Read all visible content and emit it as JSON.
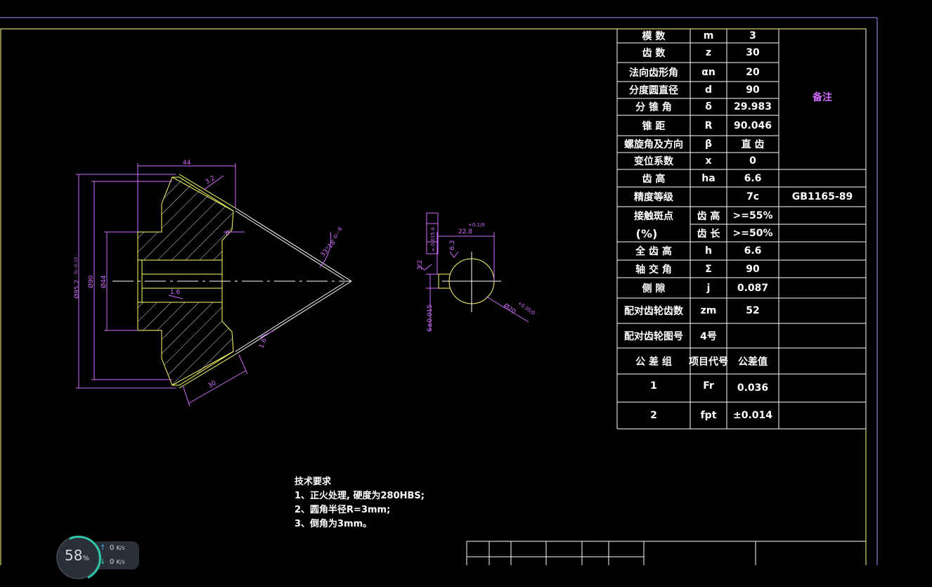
{
  "colors": {
    "frame": "#b08cff",
    "border": "#ffff80",
    "geometry": "#ffff66",
    "dimension": "#d36bff",
    "hatch": "#e0e0e0",
    "text": "#ffffff",
    "centerline": "#ffffff"
  },
  "drawing": {
    "dims": {
      "len44": "44",
      "d32": "3.2",
      "six": "6",
      "d30": "30",
      "d16a": "1.6",
      "d16b": "1.6",
      "angle": "33°18′",
      "angle_tol": "0/−8′",
      "dia952": "Ø95.2",
      "dia952_tol": "0/−0.10",
      "dia90": "Ø90",
      "dia44": "Ø44",
      "kw228": "22.8",
      "kw228_tol": "+0.1/0",
      "sym": "⌯ 0.015 A",
      "datumA": "A",
      "d32b": "3.2",
      "d63": "6.3",
      "d20": "Ø20",
      "d20_tol": "+0.05/0",
      "w6": "6±0.015"
    }
  },
  "params": {
    "rows": [
      {
        "name": "模  数",
        "sym": "m",
        "val": "3"
      },
      {
        "name": "齿  数",
        "sym": "z",
        "val": "30"
      },
      {
        "name": "法向齿形角",
        "sym": "αn",
        "val": "20"
      },
      {
        "name": "分度圆直径",
        "sym": "d",
        "val": "90"
      },
      {
        "name": "分 锥 角",
        "sym": "δ",
        "val": "29.983"
      },
      {
        "name": "锥  距",
        "sym": "R",
        "val": "90.046"
      },
      {
        "name": "螺旋角及方向",
        "sym": "β",
        "val": "直 齿"
      },
      {
        "name": "变位系数",
        "sym": "x",
        "val": "0"
      },
      {
        "name": "齿 高",
        "sym": "ha",
        "val": "6.6"
      },
      {
        "name": "精度等级",
        "sym": "",
        "val": "7c",
        "note": "GB1165-89"
      },
      {
        "name": "接触斑点",
        "name2": "(%)",
        "sym": "齿 高",
        "val": ">=55%"
      },
      {
        "name": "",
        "sym": "齿 长",
        "val": ">=50%"
      },
      {
        "name": "全 齿 高",
        "sym": "h",
        "val": "6.6"
      },
      {
        "name": "轴 交 角",
        "sym": "Σ",
        "val": "90"
      },
      {
        "name": "侧  隙",
        "sym": "j",
        "val": "0.087"
      },
      {
        "name": "配对齿轮齿数",
        "sym": "zm",
        "val": "52"
      },
      {
        "name": "配对齿轮图号",
        "sym": "4号",
        "val": ""
      },
      {
        "name": "公 差 组",
        "sym": "项目代号",
        "val": "公差值"
      },
      {
        "name": "1",
        "sym": "Fr",
        "val": "0.036"
      },
      {
        "name": "2",
        "sym": "fpt",
        "val": "±0.014"
      }
    ],
    "remark": "备注"
  },
  "tech": {
    "title": "技术要求",
    "items": [
      "1、正火处理, 硬度为280HBS;",
      "2、圆角半径R=3mm;",
      "3、倒角为3mm。"
    ]
  },
  "net_widget": {
    "cpu": "58",
    "cpu_unit": "%",
    "up": "0",
    "down": "0",
    "unit": "K/s"
  }
}
